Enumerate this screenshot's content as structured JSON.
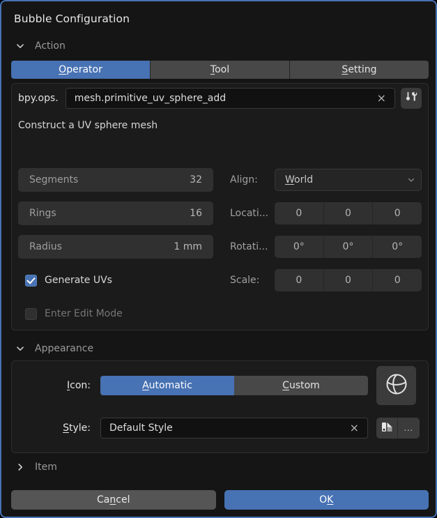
{
  "window": {
    "title": "Bubble Configuration",
    "accent_color": "#4772b3",
    "background_color": "#151515"
  },
  "action_section": {
    "header_label": "Action",
    "chevron": "chevron-down-icon",
    "tabs": [
      {
        "label_pre": "",
        "label_accel": "O",
        "label_post": "perator",
        "active": true
      },
      {
        "label_pre": "",
        "label_accel": "T",
        "label_post": "ool",
        "active": false
      },
      {
        "label_pre": "",
        "label_accel": "S",
        "label_post": "etting",
        "active": false
      }
    ],
    "operator": {
      "prefix": "bpy.ops.",
      "value": "mesh.primitive_uv_sphere_add",
      "clear_glyph": "×",
      "tool_icon": "screwdriver-wrench-icon"
    },
    "description": "Construct a UV sphere mesh",
    "left_fields": [
      {
        "type": "slider",
        "label": "Segments",
        "value": "32"
      },
      {
        "type": "slider",
        "label": "Rings",
        "value": "16"
      },
      {
        "type": "slider",
        "label": "Radius",
        "value": "1 mm"
      },
      {
        "type": "checkbox",
        "label": "Generate UVs",
        "checked": true,
        "dimmed": false
      },
      {
        "type": "checkbox",
        "label": "Enter Edit Mode",
        "checked": false,
        "dimmed": true
      }
    ],
    "right_fields": [
      {
        "type": "dropdown",
        "label": "Align:",
        "value_accel": "W",
        "value_post": "orld",
        "chevron": "chevron-down-icon"
      },
      {
        "type": "triplet",
        "label": "Locati...",
        "values": [
          "0",
          "0",
          "0"
        ]
      },
      {
        "type": "triplet",
        "label": "Rotati...",
        "values": [
          "0°",
          "0°",
          "0°"
        ]
      },
      {
        "type": "triplet",
        "label": "Scale:",
        "values": [
          "0",
          "0",
          "0"
        ]
      }
    ]
  },
  "appearance_section": {
    "header_label": "Appearance",
    "chevron": "chevron-down-icon",
    "icon_row": {
      "label_accel": "I",
      "label_post": "con:",
      "options": [
        {
          "accel": "A",
          "post": "utomatic",
          "active": true
        },
        {
          "accel": "C",
          "post": "ustom",
          "active": false
        }
      ],
      "preview_icon": "uv-sphere-icon"
    },
    "style_row": {
      "label_accel": "S",
      "label_post": "tyle:",
      "value": "Default Style",
      "clear_glyph": "×",
      "swatch_icon": "style-swatch-icon",
      "more_label": "…"
    }
  },
  "item_section": {
    "header_label": "Item",
    "chevron": "chevron-right-icon"
  },
  "buttons": {
    "cancel_pre": "Ca",
    "cancel_accel": "n",
    "cancel_post": "cel",
    "ok_pre": "O",
    "ok_accel": "K",
    "ok_post": ""
  }
}
